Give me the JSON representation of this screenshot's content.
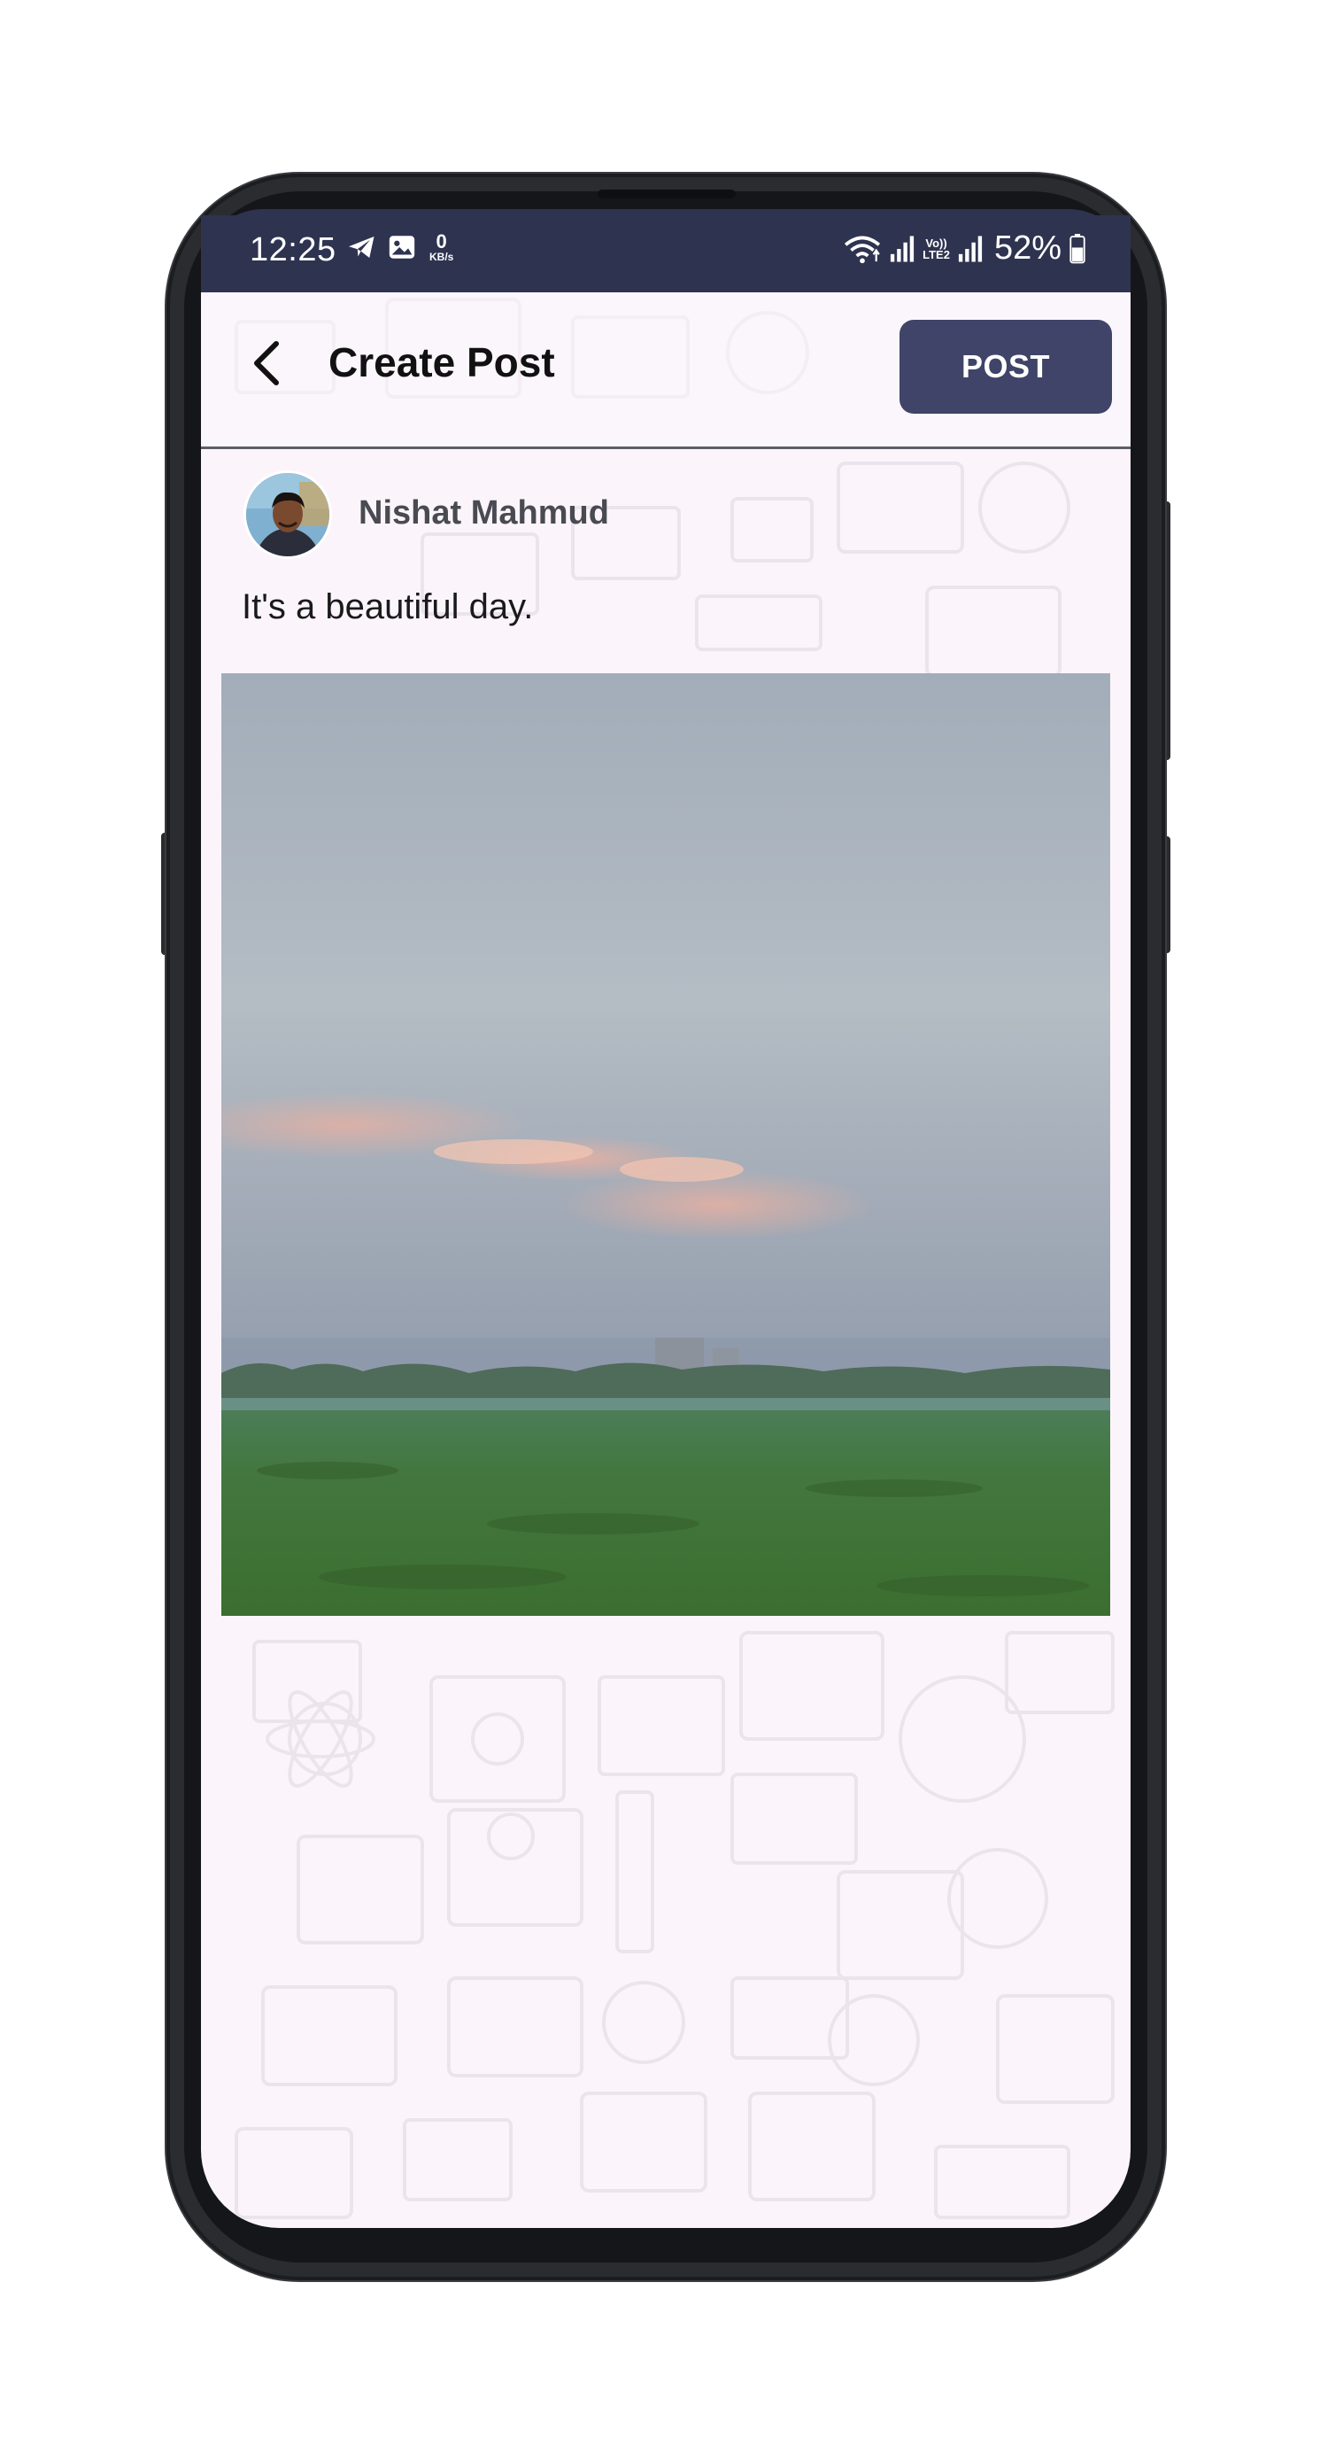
{
  "status_bar": {
    "time": "12:25",
    "net_speed_value": "0",
    "net_speed_unit": "KB/s",
    "volte_top": "Vo))",
    "volte_bottom": "LTE2",
    "battery_percent": "52%",
    "icons": [
      "telegram-icon",
      "gallery-icon",
      "wifi-icon",
      "signal-icon",
      "signal-icon",
      "battery-icon"
    ]
  },
  "app_bar": {
    "title": "Create Post",
    "post_button_label": "POST",
    "back_icon": "chevron-left-icon"
  },
  "post": {
    "author_name": "Nishat Mahmud",
    "text": "It's a beautiful day.",
    "image_description_icon": "landscape-photo"
  },
  "colors": {
    "status_bar_bg": "#2e3350",
    "screen_bg": "#fbf5fb",
    "post_button_bg": "#3f4468",
    "title_text": "#111111",
    "author_text": "#4a4a52"
  }
}
